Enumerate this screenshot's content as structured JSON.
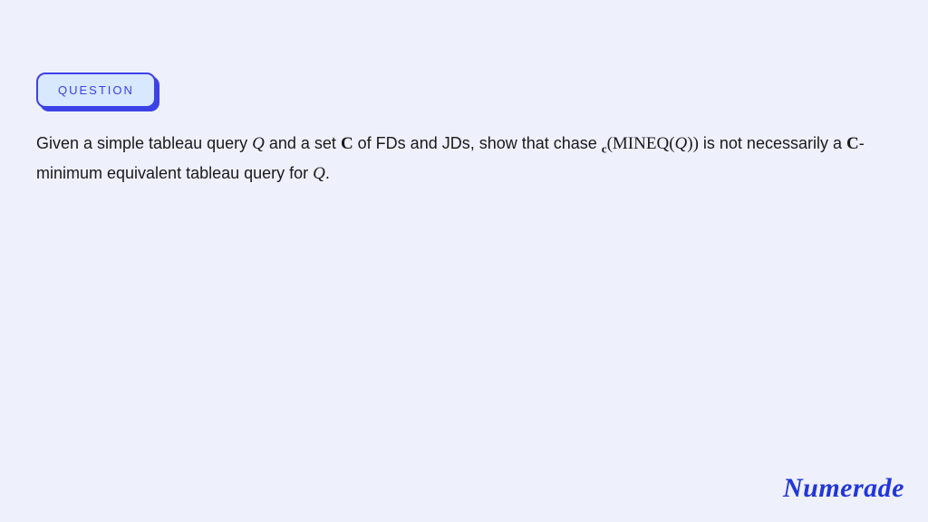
{
  "badge": {
    "label": "QUESTION"
  },
  "question": {
    "pre1": "Given a simple tableau query ",
    "Q1": "Q",
    "mid1": " and a set ",
    "C1": "C",
    "mid2": " of FDs and JDs, show that chase ",
    "sub_c": "c",
    "open1": "(",
    "mineq": "MINEQ",
    "open2": "(",
    "Q2": "Q",
    "close2": "))",
    "mid3": " is not necessarily a ",
    "C2": "C",
    "dash": "-",
    "line2a": "minimum equivalent tableau query for ",
    "Q3": "Q",
    "period": "."
  },
  "brand": {
    "name": "Numerade"
  }
}
